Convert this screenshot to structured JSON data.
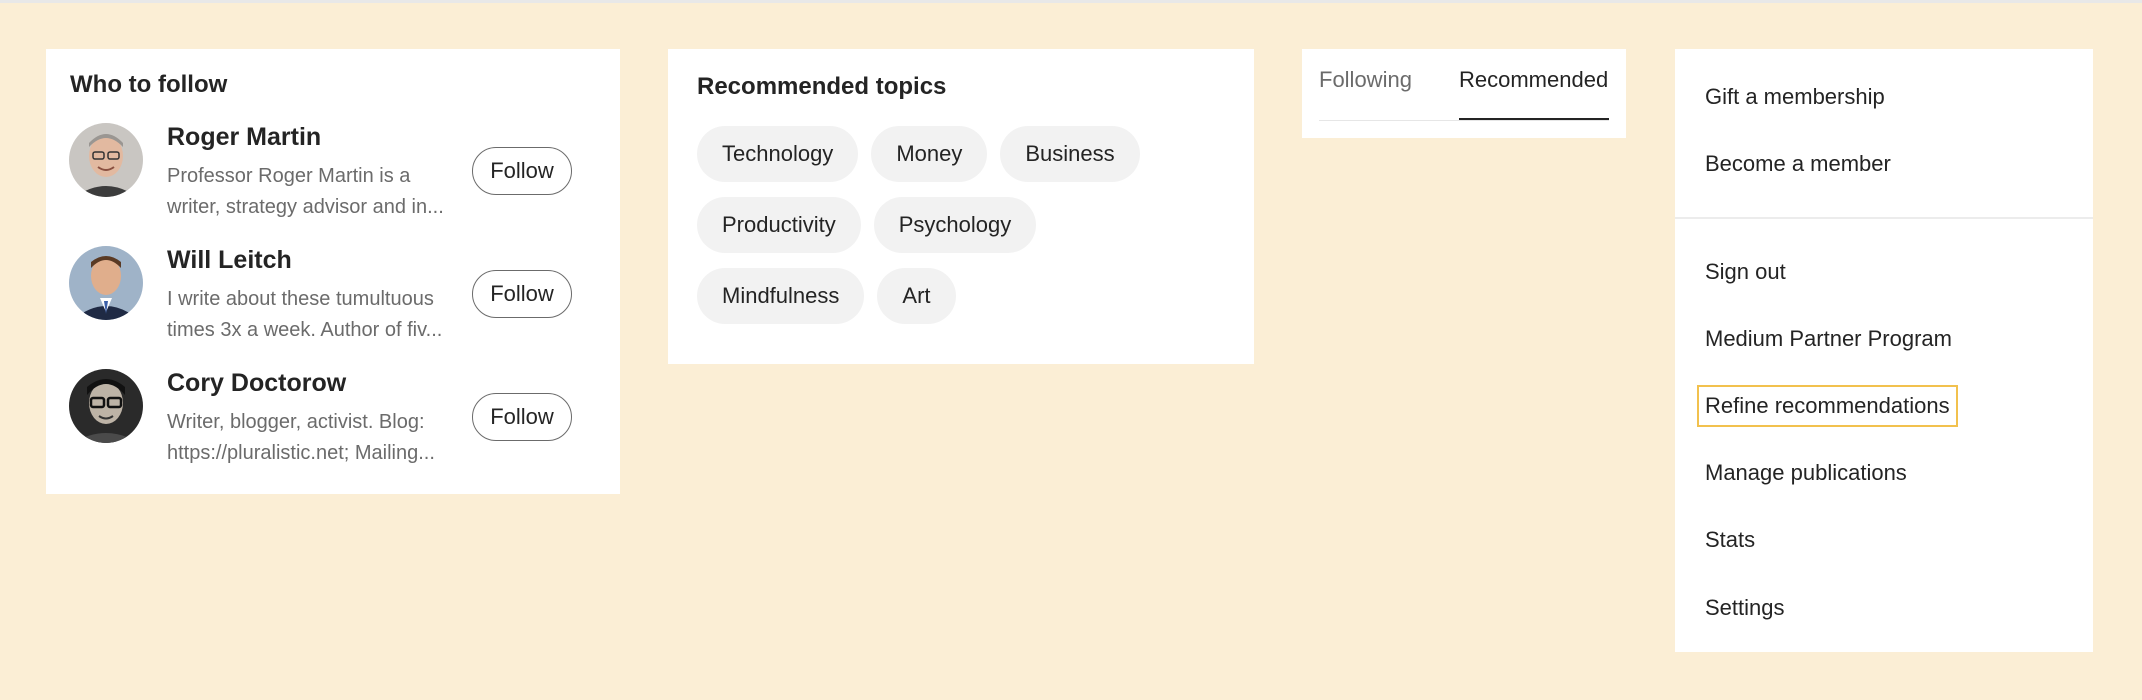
{
  "who_to_follow": {
    "title": "Who to follow",
    "follow_label": "Follow",
    "people": [
      {
        "name": "Roger Martin",
        "desc_line1": "Professor Roger Martin is a",
        "desc_line2": "writer, strategy advisor and in..."
      },
      {
        "name": "Will Leitch",
        "desc_line1": "I write about these tumultuous",
        "desc_line2": "times 3x a week. Author of fiv..."
      },
      {
        "name": "Cory Doctorow",
        "desc_line1": "Writer, blogger, activist. Blog:",
        "desc_line2": "https://pluralistic.net; Mailing..."
      }
    ]
  },
  "topics": {
    "title": "Recommended topics",
    "rows": [
      [
        "Technology",
        "Money",
        "Business"
      ],
      [
        "Productivity",
        "Psychology"
      ],
      [
        "Mindfulness",
        "Art"
      ]
    ]
  },
  "tabs": {
    "following": "Following",
    "recommended": "Recommended",
    "active": "Recommended"
  },
  "menu": {
    "items": [
      "Gift a membership",
      "Become a member",
      "Sign out",
      "Medium Partner Program",
      "Refine recommendations",
      "Manage publications",
      "Stats",
      "Settings"
    ],
    "focused_item": "Refine recommendations"
  },
  "colors": {
    "page_background": "#fbeed5",
    "panel_background": "#ffffff",
    "chip_background": "#f2f2f2",
    "focus_outline": "#f2c14e"
  }
}
